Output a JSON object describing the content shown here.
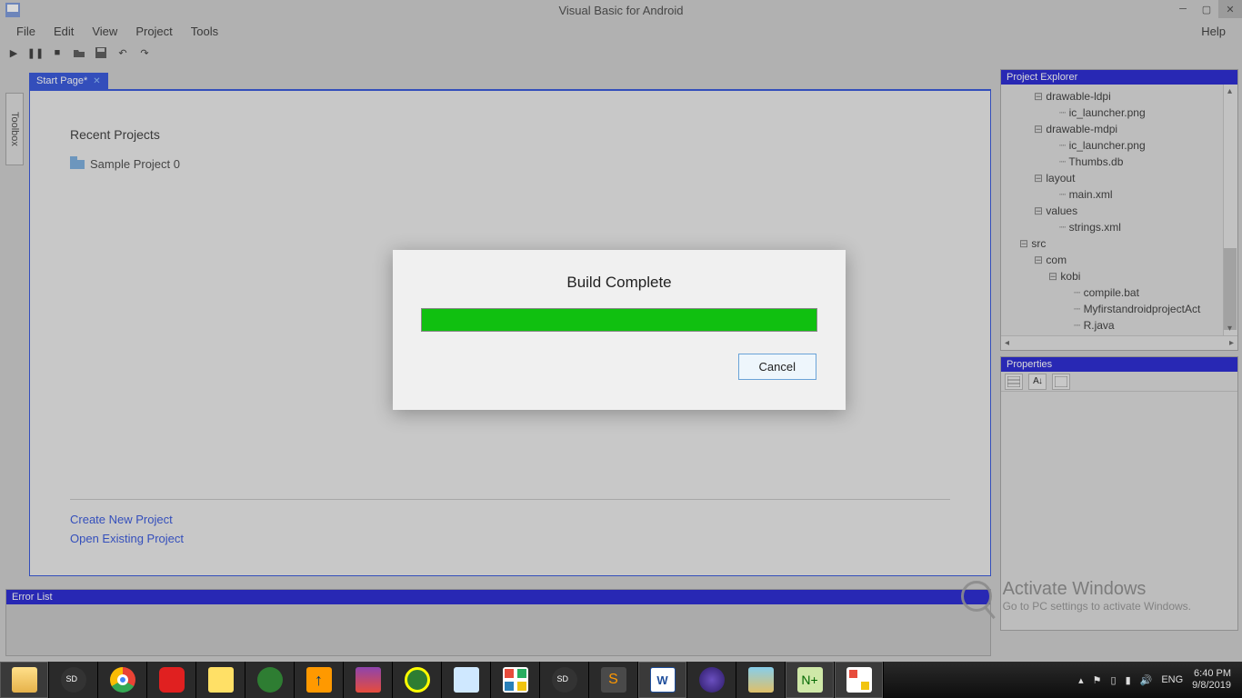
{
  "title": "Visual Basic for Android",
  "menu": {
    "file": "File",
    "edit": "Edit",
    "view": "View",
    "project": "Project",
    "tools": "Tools",
    "help": "Help"
  },
  "toolbox_label": "Toolbox",
  "tab": {
    "label": "Start Page*"
  },
  "start_page": {
    "recent_heading": "Recent Projects",
    "recent_item_0": "Sample Project 0",
    "create_new": "Create New Project",
    "open_existing": "Open Existing Project"
  },
  "error_panel": "Error List",
  "explorer": {
    "title": "Project Explorer",
    "rows": [
      "drawable-ldpi",
      "ic_launcher.png",
      "drawable-mdpi",
      "ic_launcher.png",
      "Thumbs.db",
      "layout",
      "main.xml",
      "values",
      "strings.xml",
      "src",
      "com",
      "kobi",
      "compile.bat",
      "MyfirstandroidprojectAct",
      "R.java"
    ]
  },
  "properties": {
    "title": "Properties"
  },
  "dialog": {
    "title": "Build Complete",
    "cancel": "Cancel"
  },
  "watermark": {
    "line1": "Activate Windows",
    "line2": "Go to PC settings to activate Windows."
  },
  "tray": {
    "lang": "ENG",
    "time": "6:40 PM",
    "date": "9/8/2019"
  }
}
